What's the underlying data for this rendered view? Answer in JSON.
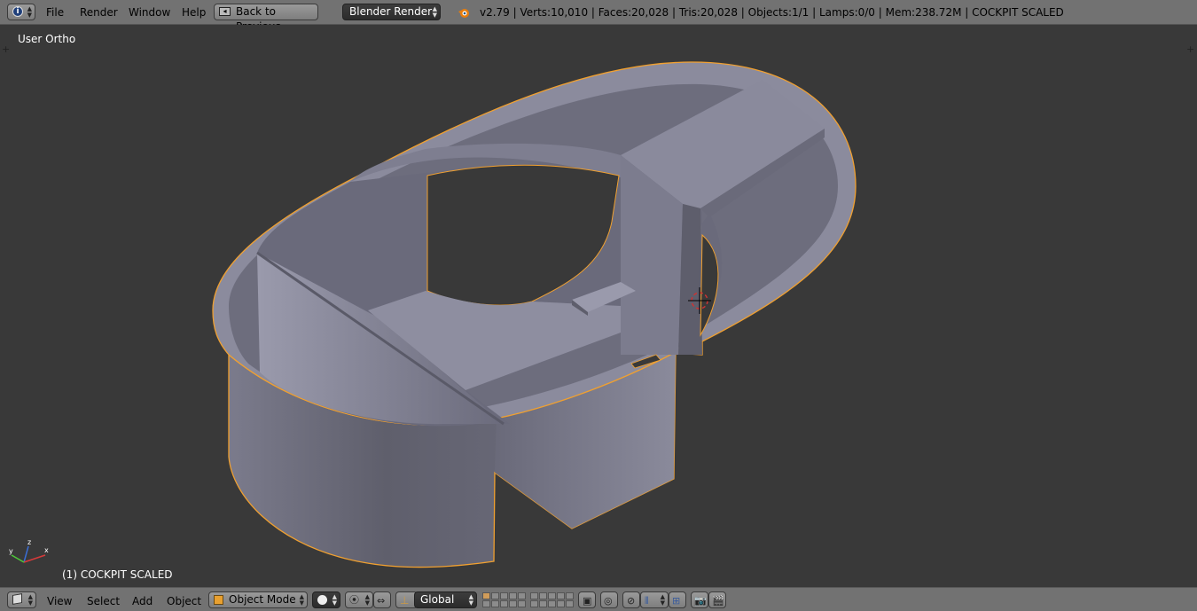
{
  "topbar": {
    "editor_icon": "info-icon",
    "menus": [
      "File",
      "Render",
      "Window",
      "Help"
    ],
    "back_button": "Back to Previous",
    "render_engine": "Blender Render",
    "stats": "v2.79 | Verts:10,010 | Faces:20,028 | Tris:20,028 | Objects:1/1 | Lamps:0/0 | Mem:238.72M | COCKPIT SCALED"
  },
  "viewport": {
    "view_name": "User Ortho",
    "object_label": "(1) COCKPIT SCALED",
    "selection_outline_color": "#f0a030",
    "mesh_color": "#8a8a9c",
    "background_color": "#393939"
  },
  "bottombar": {
    "menus": [
      "View",
      "Select",
      "Add",
      "Object"
    ],
    "mode": "Object Mode",
    "orientation": "Global",
    "icons": [
      "viewport-shading-icon",
      "pivot-point-icon",
      "manipulator-icon",
      "transform-orientation-icon",
      "layers-icon",
      "lock-camera-icon",
      "proportional-edit-icon",
      "snap-icon",
      "snap-target-icon",
      "render-icon",
      "render-animation-icon"
    ]
  }
}
